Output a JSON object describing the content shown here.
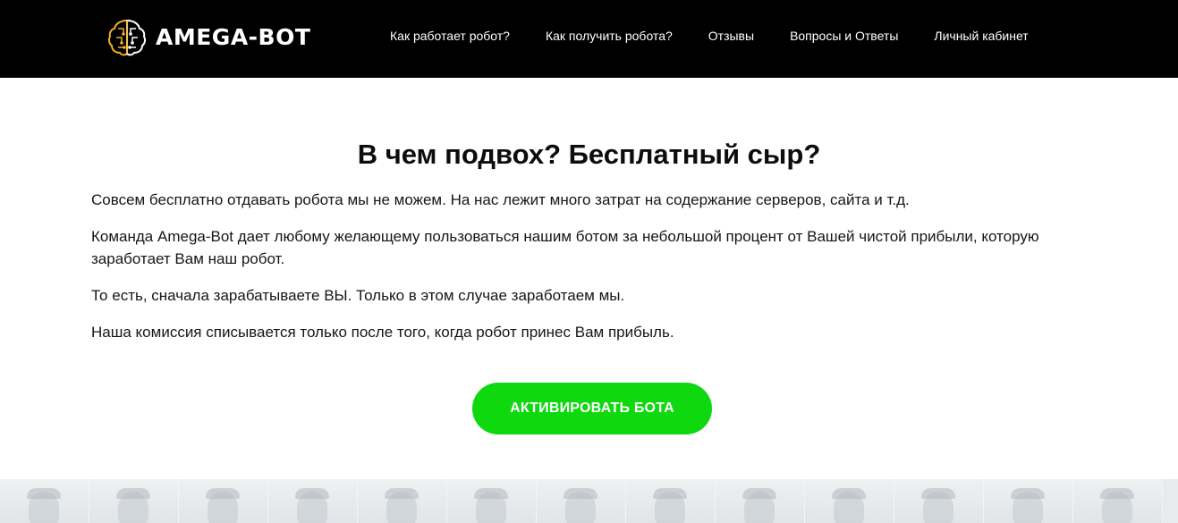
{
  "header": {
    "logo_text": "AMEGA-BOT",
    "logo_icon": "brain-circuit-icon",
    "nav": [
      {
        "label": "Как работает робот?"
      },
      {
        "label": "Как получить робота?"
      },
      {
        "label": "Отзывы"
      },
      {
        "label": "Вопросы и Ответы"
      },
      {
        "label": "Личный кабинет"
      }
    ]
  },
  "main": {
    "title": "В чем подвох? Бесплатный сыр?",
    "paragraphs": [
      "Совсем бесплатно отдавать робота мы не можем. На нас лежит много затрат на содержание серверов, сайта и т.д.",
      "Команда Amega-Bot дает любому желающему пользоваться нашим ботом за небольшой процент от Вашей чистой прибыли, которую заработает Вам наш робот.",
      "То есть, сначала зарабатываете ВЫ. Только в этом случае заработаем мы.",
      "Наша комиссия списывается только после того, когда робот принес Вам прибыль."
    ],
    "cta_label": "АКТИВИРОВАТЬ БОТА"
  },
  "colors": {
    "header_bg": "#000000",
    "cta_bg": "#0ed80e",
    "logo_accent": "#f2b01e",
    "bottom_strip": "#e8ebee"
  }
}
